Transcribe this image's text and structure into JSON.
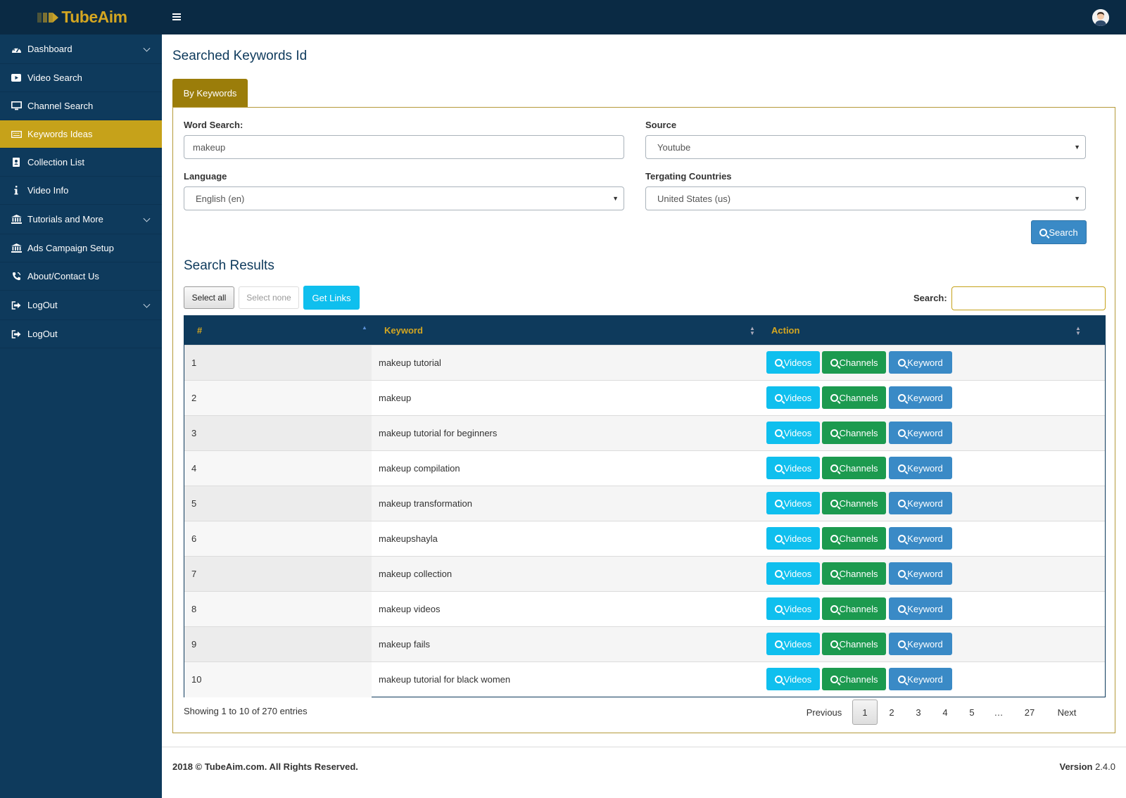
{
  "app": {
    "brand": "TubeAim"
  },
  "sidebar": {
    "items": [
      {
        "label": "Dashboard",
        "icon": "dashboard-icon"
      },
      {
        "label": "Video Search",
        "icon": "video-icon"
      },
      {
        "label": "Channel Search",
        "icon": "monitor-icon"
      },
      {
        "label": "Keywords Ideas",
        "icon": "keyboard-icon",
        "active": true
      },
      {
        "label": "Collection List",
        "icon": "address-book-icon"
      },
      {
        "label": "Video Info",
        "icon": "info-icon"
      },
      {
        "label": "Tutorials and More",
        "icon": "bank-icon"
      },
      {
        "label": "Ads Campaign Setup",
        "icon": "bank-icon"
      },
      {
        "label": "About/Contact Us",
        "icon": "phone-icon"
      },
      {
        "label": "LogOut",
        "icon": "sign-out-icon"
      },
      {
        "label": "LogOut",
        "icon": "sign-out-icon"
      }
    ]
  },
  "page": {
    "title": "Searched Keywords Id",
    "tab": "By Keywords"
  },
  "form": {
    "word_search_label": "Word Search:",
    "word_search_value": "makeup",
    "source_label": "Source",
    "source_value": "Youtube",
    "language_label": "Language",
    "language_value": "English (en)",
    "countries_label": "Tergating Countries",
    "countries_value": "United States (us)",
    "search_button": "Search"
  },
  "results": {
    "title": "Search Results",
    "select_all": "Select all",
    "select_none": "Select none",
    "get_links": "Get Links",
    "search_label": "Search:",
    "columns": {
      "num": "#",
      "keyword": "Keyword",
      "action": "Action"
    },
    "action_labels": {
      "videos": "Videos",
      "channels": "Channels",
      "keyword": "Keyword"
    },
    "rows": [
      {
        "num": "1",
        "keyword": "makeup tutorial"
      },
      {
        "num": "2",
        "keyword": "makeup"
      },
      {
        "num": "3",
        "keyword": "makeup tutorial for beginners"
      },
      {
        "num": "4",
        "keyword": "makeup compilation"
      },
      {
        "num": "5",
        "keyword": "makeup transformation"
      },
      {
        "num": "6",
        "keyword": "makeupshayla"
      },
      {
        "num": "7",
        "keyword": "makeup collection"
      },
      {
        "num": "8",
        "keyword": "makeup videos"
      },
      {
        "num": "9",
        "keyword": "makeup fails"
      },
      {
        "num": "10",
        "keyword": "makeup tutorial for black women"
      }
    ],
    "showing": "Showing 1 to 10 of 270 entries",
    "pagination": {
      "previous": "Previous",
      "pages": [
        "1",
        "2",
        "3",
        "4",
        "5",
        "…",
        "27"
      ],
      "current": "1",
      "next": "Next"
    }
  },
  "footer": {
    "copyright": "2018 © TubeAim.com. All Rights Reserved.",
    "version_label": "Version",
    "version_value": "2.4.0"
  },
  "colors": {
    "sidebar": "#0e3a5c",
    "topbar": "#0a2a44",
    "accent": "#c6a21a",
    "videos": "#0fbfee",
    "channels": "#1c9a4f",
    "keyword": "#3a8ac6"
  }
}
